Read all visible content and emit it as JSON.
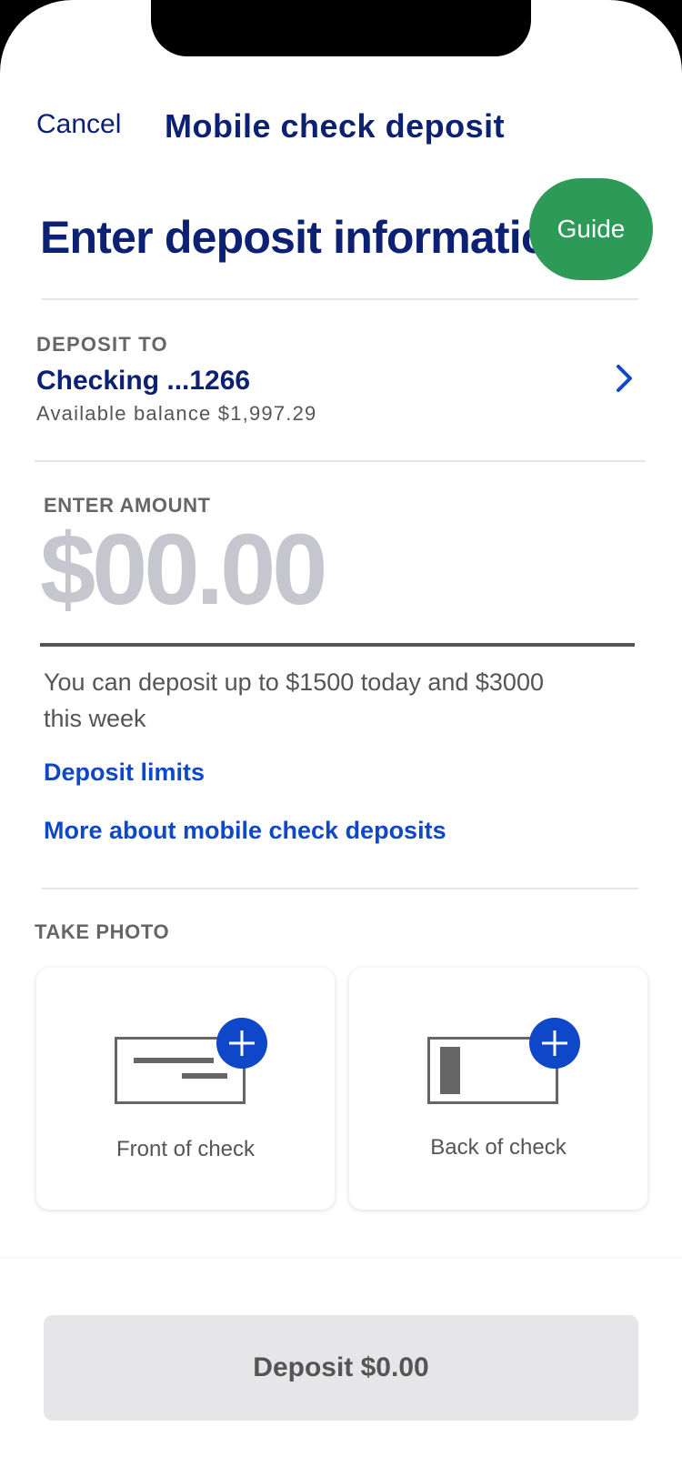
{
  "header": {
    "cancel_label": "Cancel",
    "title": "Mobile check deposit"
  },
  "page_heading": "Enter deposit informatio",
  "guide_label": "Guide",
  "deposit_to": {
    "label": "DEPOSIT TO",
    "account": "Checking ...1266",
    "balance": "Available balance $1,997.29",
    "icon": "chevron-right-icon"
  },
  "amount": {
    "label": "ENTER AMOUNT",
    "value": "$00.00",
    "limit_text": "You can deposit up to $1500 today and $3000 this week",
    "deposit_limits_link": "Deposit limits",
    "more_link": "More about mobile check deposits"
  },
  "photo": {
    "label": "TAKE PHOTO",
    "front_label": "Front of check",
    "back_label": "Back of check",
    "icon": "plus-icon"
  },
  "footer": {
    "deposit_button": "Deposit $0.00"
  },
  "colors": {
    "navy": "#0c2074",
    "link_blue": "#0f47c9",
    "guide_green": "#2e9a58",
    "placeholder_gray": "#c6c6ce"
  }
}
